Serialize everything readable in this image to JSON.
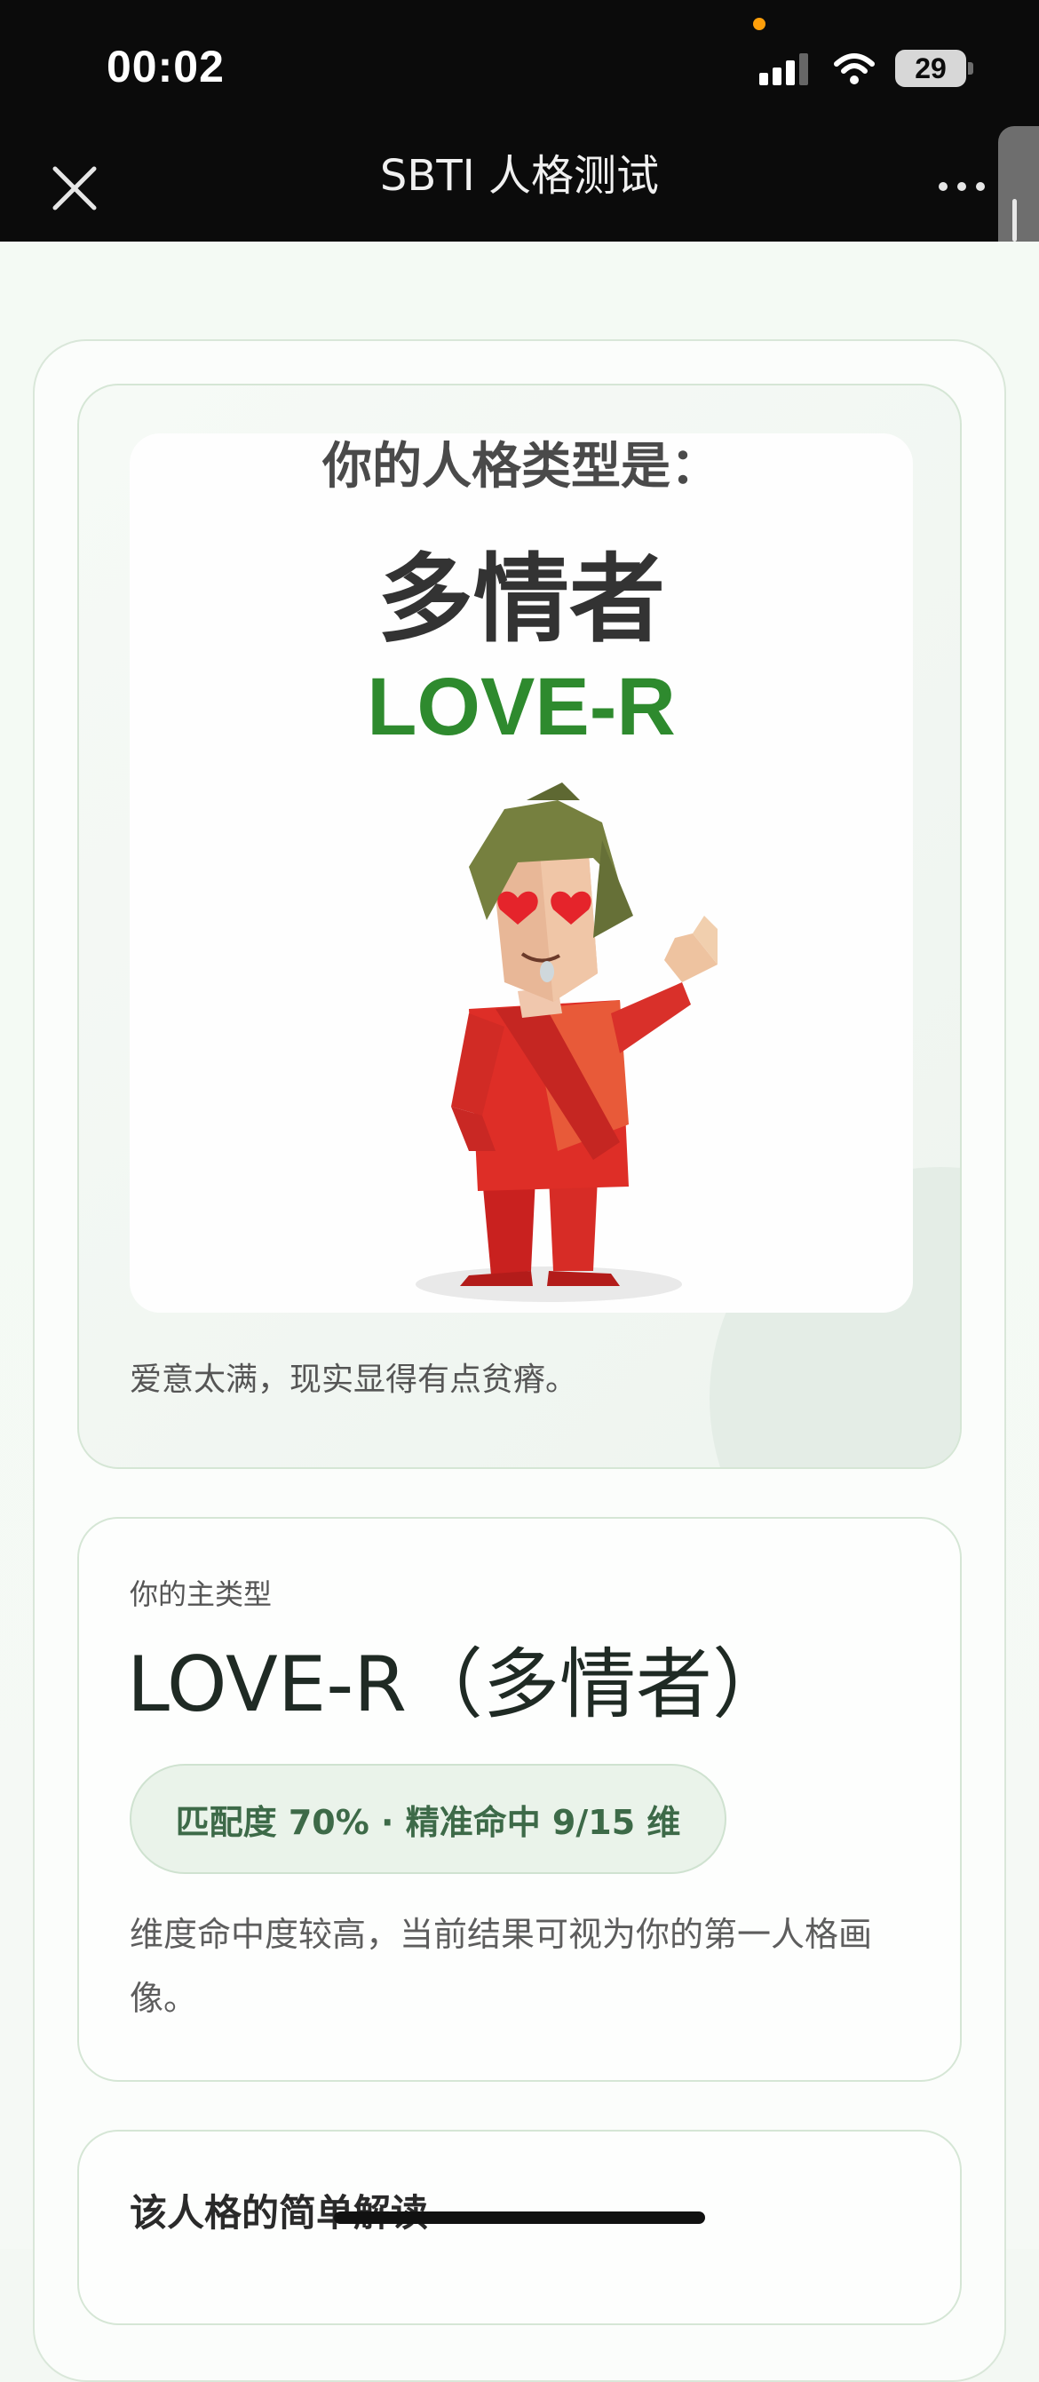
{
  "status_bar": {
    "time": "00:02",
    "battery": "29"
  },
  "navbar": {
    "title": "SBTI 人格测试"
  },
  "hero": {
    "heading": "你的人格类型是：",
    "type_cn": "多情者",
    "type_code": "LOVE-R",
    "tagline": "爱意太满，现实显得有点贫瘠。"
  },
  "main_type": {
    "label": "你的主类型",
    "title": "LOVE-R（多情者）",
    "match_badge": "匹配度 70% · 精准命中 9/15 维",
    "description": "维度命中度较高，当前结果可视为你的第一人格画像。"
  },
  "analysis": {
    "title": "该人格的简单解读"
  },
  "colors": {
    "accent_green": "#2e8a2e",
    "badge_bg": "#eaf3ea",
    "badge_text": "#3d6a48"
  }
}
